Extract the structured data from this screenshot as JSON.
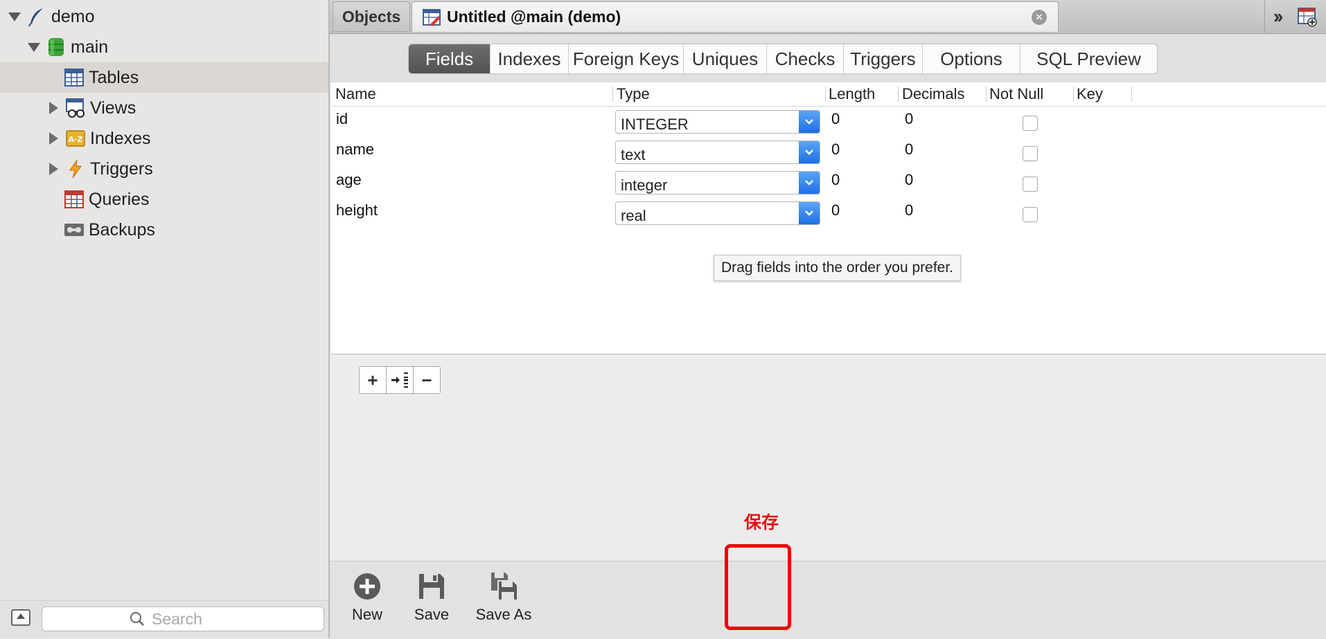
{
  "sidebar": {
    "items": [
      {
        "label": "demo",
        "icon": "feather-icon"
      },
      {
        "label": "main",
        "icon": "database-icon"
      },
      {
        "label": "Tables",
        "icon": "table-icon"
      },
      {
        "label": "Views",
        "icon": "view-glasses-icon"
      },
      {
        "label": "Indexes",
        "icon": "index-az-icon"
      },
      {
        "label": "Triggers",
        "icon": "lightning-icon"
      },
      {
        "label": "Queries",
        "icon": "query-grid-icon"
      },
      {
        "label": "Backups",
        "icon": "tape-icon"
      }
    ],
    "selected": "Tables",
    "search": {
      "placeholder": "Search"
    }
  },
  "tabs": {
    "objects": "Objects",
    "document": "Untitled @main (demo)"
  },
  "segments": [
    "Fields",
    "Indexes",
    "Foreign Keys",
    "Uniques",
    "Checks",
    "Triggers",
    "Options",
    "SQL Preview"
  ],
  "active_segment": "Fields",
  "grid": {
    "columns": [
      "Name",
      "Type",
      "Length",
      "Decimals",
      "Not Null",
      "Key"
    ],
    "rows": [
      {
        "name": "id",
        "type": "INTEGER",
        "length": "0",
        "decimals": "0",
        "not_null": false
      },
      {
        "name": "name",
        "type": "text",
        "length": "0",
        "decimals": "0",
        "not_null": false
      },
      {
        "name": "age",
        "type": "integer",
        "length": "0",
        "decimals": "0",
        "not_null": false
      },
      {
        "name": "height",
        "type": "real",
        "length": "0",
        "decimals": "0",
        "not_null": false
      }
    ]
  },
  "tooltip": "Drag fields into the order you prefer.",
  "row_buttons": [
    "+",
    "→",
    "−"
  ],
  "annotation": "保存",
  "toolbar": {
    "new_label": "New",
    "save_label": "Save",
    "save_as_label": "Save As"
  },
  "colors": {
    "highlight": "#e00000",
    "accent": "#1e6fe6",
    "active_segment": "#5a5a5a"
  }
}
